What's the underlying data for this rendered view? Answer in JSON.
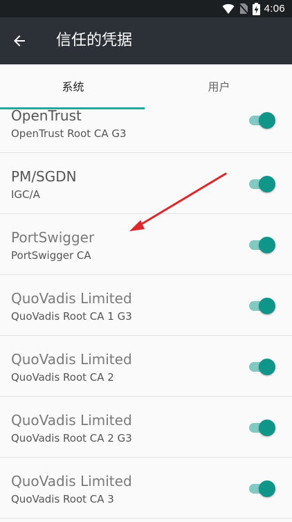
{
  "status_bar": {
    "time": "4:06"
  },
  "app_bar": {
    "title": "信任的凭据"
  },
  "tabs": [
    {
      "label": "系统",
      "selected": true
    },
    {
      "label": "用户",
      "selected": false
    }
  ],
  "accent_color": "#26a69a",
  "credentials": [
    {
      "name": "OpenTrust",
      "issuer": "OpenTrust Root CA G3",
      "enabled": true
    },
    {
      "name": "PM/SGDN",
      "issuer": "IGC/A",
      "enabled": true
    },
    {
      "name": "PortSwigger",
      "issuer": "PortSwigger CA",
      "enabled": true
    },
    {
      "name": "QuoVadis Limited",
      "issuer": "QuoVadis Root CA 1 G3",
      "enabled": true
    },
    {
      "name": "QuoVadis Limited",
      "issuer": "QuoVadis Root CA 2",
      "enabled": true
    },
    {
      "name": "QuoVadis Limited",
      "issuer": "QuoVadis Root CA 2 G3",
      "enabled": true
    },
    {
      "name": "QuoVadis Limited",
      "issuer": "QuoVadis Root CA 3",
      "enabled": true
    }
  ]
}
